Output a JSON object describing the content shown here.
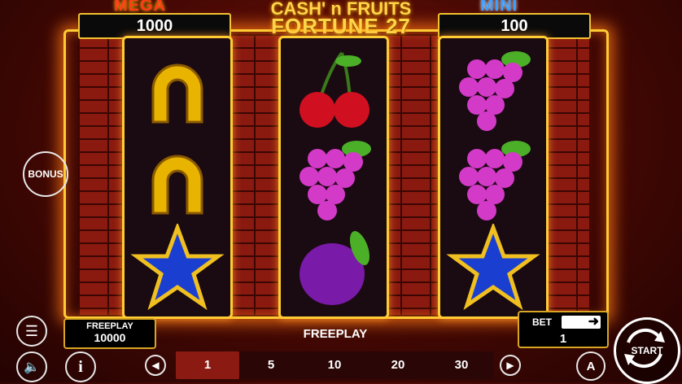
{
  "title": {
    "line1": "CASH' n FRUITS",
    "line2": "FORTUNE 27"
  },
  "jackpots": {
    "mega": {
      "label": "MEGA",
      "value": "1000"
    },
    "mini": {
      "label": "MINI",
      "value": "100"
    }
  },
  "bonus_label": "BONUS",
  "freeplay_panel": {
    "label": "FREEPLAY",
    "value": "10000"
  },
  "status_text": "FREEPLAY",
  "bet_panel": {
    "label": "BET",
    "value": "1"
  },
  "bet_options": [
    "1",
    "5",
    "10",
    "20",
    "30"
  ],
  "selected_bet": "1",
  "start_label": "START",
  "auto_label": "A",
  "reels": [
    [
      "horseshoe",
      "horseshoe",
      "blue-star"
    ],
    [
      "cherries",
      "grapes",
      "plum"
    ],
    [
      "grapes",
      "grapes",
      "blue-star"
    ]
  ],
  "colors": {
    "accent": "#ffcc33",
    "brick": "#8a1a10",
    "mega": "#ff3b1a",
    "mini": "#3aa0ff"
  }
}
